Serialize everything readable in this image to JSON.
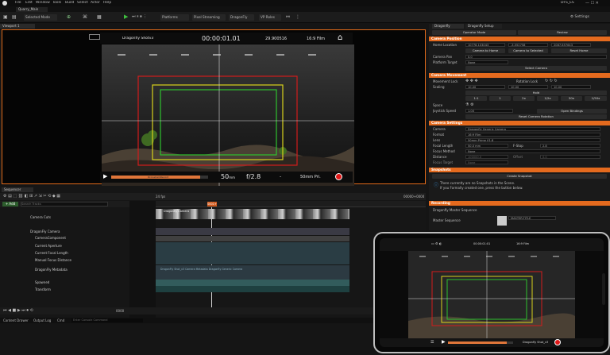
{
  "app": {
    "menus": [
      "File",
      "Edit",
      "Window",
      "Tools",
      "Build",
      "Select",
      "Actor",
      "Help"
    ],
    "project_tab": "Quarry_Main",
    "project_label": "DFS_ES",
    "settings_label": "Settings"
  },
  "toolbar": {
    "mode": "Selected Mode",
    "platforms": "Platforms",
    "pixel_streaming": "Pixel Streaming",
    "dragonfly": "DragonFly",
    "vp_roles": "VP Roles"
  },
  "viewport": {
    "tab": "Viewport 1",
    "hud_title": "Dragonfly Shotv3",
    "timecode": "00:00:01.01",
    "fps": "29.900516",
    "format": "16:9 Film",
    "focal": "50",
    "focal_unit": "mm",
    "aperture": "f/2.",
    "aperture_suffix": "8",
    "dash": "-",
    "lens": "50mm Pri.",
    "progress_label": "DroneCamRecord"
  },
  "right_panel": {
    "tabs": [
      "Dragonfly",
      "Dragonfly Setup"
    ],
    "top_buttons": [
      "Operator Mode",
      "Review"
    ],
    "sections": {
      "camera_position": "Camera Position",
      "camera_movement": "Camera Movement",
      "camera_settings": "Camera Settings",
      "snapshots": "Snapshots",
      "recording": "Recording"
    },
    "home_location_label": "Home Location",
    "home_location_values": [
      "10778.103043",
      "-3.552758",
      "2087.657643"
    ],
    "camera_to_home": "Camera to Home",
    "camera_to_selected": "Camera to Selected",
    "reset_home": "Reset Home",
    "camera_pan_label": "Camera Pan",
    "camera_pan_value": "0.0",
    "platform_target_label": "Platform Target",
    "platform_target_value": "None",
    "select_camera": "Select Camera",
    "movement_lock": "Movement Lock",
    "rotation_lock": "Rotation Lock",
    "scaling_label": "Scaling",
    "scaling_values": [
      "10.00",
      "10.00",
      "10.00"
    ],
    "hold": "Hold",
    "scale_steps": [
      "1:1",
      "1",
      "2x",
      "1/2x",
      "50x",
      "1/50x"
    ],
    "space_label": "Space",
    "joystick_speed_label": "Joystick Speed",
    "joystick_speed_value": "1.00",
    "open_bindings": "Open Bindings",
    "reset_camera_rotation": "Reset Camera Rotation",
    "camera_label": "Camera",
    "camera_value": "Dragonfly Generic Camera",
    "format_label": "Format",
    "format_value": "16:9 Film",
    "lens_label": "Lens",
    "lens_value": "50mm Prime f/1.8",
    "focal_length_label": "Focal Length",
    "focal_length_value": "50.0 mm",
    "fstop_label": "F-Stop",
    "fstop_value": "2.8",
    "focus_method_label": "Focus Method",
    "focus_method_value": "None",
    "distance_label": "Distance",
    "distance_value": "100000.0",
    "offset_label": "Offset",
    "offset_value": "0.0",
    "focus_target_label": "Focus Target",
    "focus_target_value": "None",
    "create_snapshot": "Create Snapshot",
    "snapshot_msg_1": "There currently are no Snapshots in the Scene.",
    "snapshot_msg_2": "If you Formally created one, press the button below.",
    "master_sequence_hdr": "Dragonfly Master Sequence",
    "master_sequence_label": "Master Sequence",
    "master_sequence_value": "MASTER-TITLE"
  },
  "sequencer": {
    "tab": "Sequencer",
    "track_button": "+ Add",
    "search_placeholder": "Search Tracks",
    "fps": "24 fps",
    "time_readout": "0000",
    "timecode_end": "00000+0000",
    "tracks": [
      {
        "name": "Camera Cuts",
        "indent": 1
      },
      {
        "name": "DragonFly Camera",
        "indent": 1
      },
      {
        "name": "CameraComponent",
        "indent": 2
      },
      {
        "name": "Current Aperture",
        "indent": 3
      },
      {
        "name": "Current Focal Length",
        "indent": 3
      },
      {
        "name": "Manual Focus Distance",
        "indent": 3
      },
      {
        "name": "DragonFly Metadata",
        "indent": 2
      },
      {
        "name": "Spawned",
        "indent": 2
      },
      {
        "name": "Transform",
        "indent": 2
      }
    ],
    "clip_label": "Dragonfly Camera",
    "metadata_clip": "DragonFly Shot_v3 Camera Metadata Dragonfly Generic Camera",
    "frame_marker": "0001+"
  },
  "status": {
    "content_drawer": "Content Drawer",
    "output_log": "Output Log",
    "cmd": "Cmd",
    "console_placeholder": "Enter Console Command"
  },
  "phone": {
    "progress_label": "DroneCam",
    "shot_label": "Dragonfly Shot_v3",
    "timecode": "00:00:01:01",
    "top_label": "16:9 Film"
  }
}
